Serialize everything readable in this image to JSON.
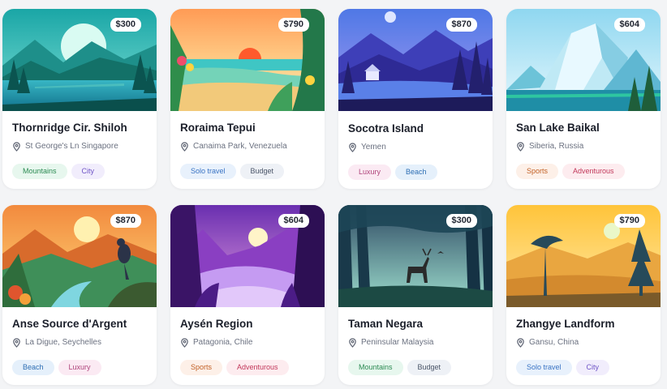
{
  "cards": [
    {
      "title": "Thornridge Cir. Shiloh",
      "location": "St George's Ln Singapore",
      "price": "$300",
      "tags": [
        {
          "label": "Mountains",
          "kind": "mountains"
        },
        {
          "label": "City",
          "kind": "city"
        }
      ]
    },
    {
      "title": "Roraima Tepui",
      "location": "Canaima Park, Venezuela",
      "price": "$790",
      "tags": [
        {
          "label": "Solo travel",
          "kind": "solo"
        },
        {
          "label": "Budget",
          "kind": "budget"
        }
      ]
    },
    {
      "title": "Socotra Island",
      "location": "Yemen",
      "price": "$870",
      "tags": [
        {
          "label": "Luxury",
          "kind": "luxury"
        },
        {
          "label": "Beach",
          "kind": "beach"
        }
      ]
    },
    {
      "title": "San Lake Baikal",
      "location": "Siberia, Russia",
      "price": "$604",
      "tags": [
        {
          "label": "Sports",
          "kind": "sports"
        },
        {
          "label": "Adventurous",
          "kind": "adventurous"
        }
      ]
    },
    {
      "title": "Anse Source d'Argent",
      "location": "La Digue, Seychelles",
      "price": "$870",
      "tags": [
        {
          "label": "Beach",
          "kind": "beach"
        },
        {
          "label": "Luxury",
          "kind": "luxury"
        }
      ]
    },
    {
      "title": "Aysén Region",
      "location": "Patagonia, Chile",
      "price": "$604",
      "tags": [
        {
          "label": "Sports",
          "kind": "sports"
        },
        {
          "label": "Adventurous",
          "kind": "adventurous"
        }
      ]
    },
    {
      "title": "Taman Negara",
      "location": "Peninsular Malaysia",
      "price": "$300",
      "tags": [
        {
          "label": "Mountains",
          "kind": "mountains"
        },
        {
          "label": "Budget",
          "kind": "budget"
        }
      ]
    },
    {
      "title": "Zhangye Landform",
      "location": "Gansu, China",
      "price": "$790",
      "tags": [
        {
          "label": "Solo travel",
          "kind": "solo"
        },
        {
          "label": "City",
          "kind": "city"
        }
      ]
    }
  ],
  "icons": {
    "location": "map-pin-icon"
  },
  "colors": {
    "background": "#f3f4f6",
    "card": "#ffffff",
    "title": "#1b1f2a",
    "muted": "#6b7180"
  }
}
